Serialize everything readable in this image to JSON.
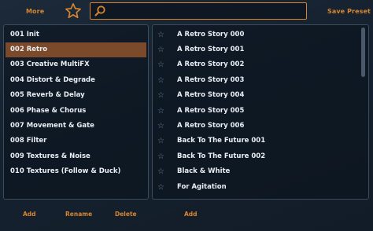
{
  "header": {
    "more_label": "More",
    "save_label": "Save Preset",
    "search_value": "",
    "search_placeholder": ""
  },
  "colors": {
    "accent": "#d9842e",
    "selected_row": "#7a4a2a",
    "background": "#162230"
  },
  "icons": {
    "favorite": "star-outline-icon",
    "search": "search-icon",
    "list_star": "star-outline-icon"
  },
  "categories": [
    {
      "label": "001 Init"
    },
    {
      "label": "002 Retro"
    },
    {
      "label": "003 Creative MultiFX"
    },
    {
      "label": "004 Distort & Degrade"
    },
    {
      "label": "005 Reverb & Delay"
    },
    {
      "label": "006 Phase & Chorus"
    },
    {
      "label": "007 Movement & Gate"
    },
    {
      "label": "008 Filter"
    },
    {
      "label": "009 Textures & Noise"
    },
    {
      "label": "010 Textures (Follow & Duck)"
    }
  ],
  "selected_category": "002 Retro",
  "presets": [
    {
      "label": "A Retro Story 000"
    },
    {
      "label": "A Retro Story 001"
    },
    {
      "label": "A Retro Story 002"
    },
    {
      "label": "A Retro Story 003"
    },
    {
      "label": "A Retro Story 004"
    },
    {
      "label": "A Retro Story 005"
    },
    {
      "label": "A Retro Story 006"
    },
    {
      "label": "Back To The Future 001"
    },
    {
      "label": "Back To The Future 002"
    },
    {
      "label": "Black & White"
    },
    {
      "label": "For Agitation"
    }
  ],
  "footer": {
    "add_left": "Add",
    "rename": "Rename",
    "delete": "Delete",
    "add_right": "Add"
  }
}
